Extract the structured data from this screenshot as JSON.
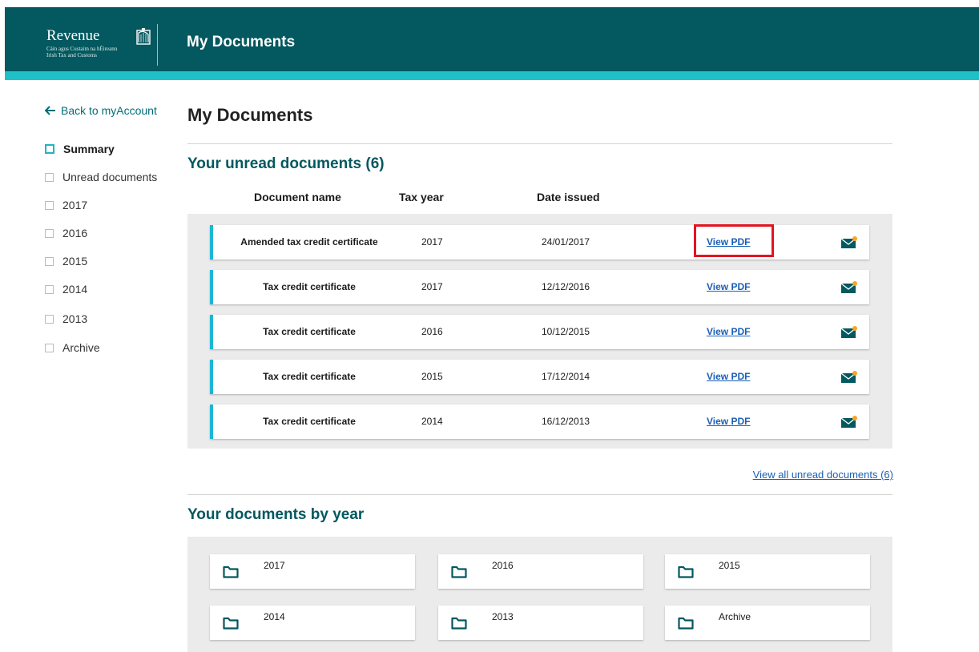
{
  "header": {
    "logo_name": "Revenue",
    "logo_sub1": "Cáin agus Custaim na hÉireann",
    "logo_sub2": "Irish Tax and Customs",
    "title": "My Documents"
  },
  "sidebar": {
    "back_label": "Back to myAccount",
    "items": [
      {
        "label": "Summary"
      },
      {
        "label": "Unread documents"
      },
      {
        "label": "2017"
      },
      {
        "label": "2016"
      },
      {
        "label": "2015"
      },
      {
        "label": "2014"
      },
      {
        "label": "2013"
      },
      {
        "label": "Archive"
      }
    ]
  },
  "main": {
    "title": "My Documents",
    "unread": {
      "title": "Your unread documents (6)",
      "columns": {
        "name": "Document name",
        "year": "Tax year",
        "date": "Date issued"
      },
      "rows": [
        {
          "name": "Amended tax credit certificate",
          "year": "2017",
          "date": "24/01/2017",
          "link": "View PDF"
        },
        {
          "name": "Tax credit certificate",
          "year": "2017",
          "date": "12/12/2016",
          "link": "View PDF"
        },
        {
          "name": "Tax credit certificate",
          "year": "2016",
          "date": "10/12/2015",
          "link": "View PDF"
        },
        {
          "name": "Tax credit certificate",
          "year": "2015",
          "date": "17/12/2014",
          "link": "View PDF"
        },
        {
          "name": "Tax credit certificate",
          "year": "2014",
          "date": "16/12/2013",
          "link": "View PDF"
        }
      ],
      "view_all": "View all unread documents (6)"
    },
    "by_year": {
      "title": "Your documents by year",
      "folders": [
        {
          "label": "2017"
        },
        {
          "label": "2016"
        },
        {
          "label": "2015"
        },
        {
          "label": "2014"
        },
        {
          "label": "2013"
        },
        {
          "label": "Archive"
        }
      ]
    }
  },
  "colors": {
    "header_bg": "#04585f",
    "header_stripe": "#1fc1c8",
    "accent_bar": "#1fb6d6",
    "link": "#1a5fb4",
    "highlight": "#e3141f",
    "notification_dot": "#f5a623"
  },
  "icons": {
    "back": "arrow-left-icon",
    "mail": "mail-icon",
    "folder": "folder-icon",
    "harp": "harp-icon"
  }
}
